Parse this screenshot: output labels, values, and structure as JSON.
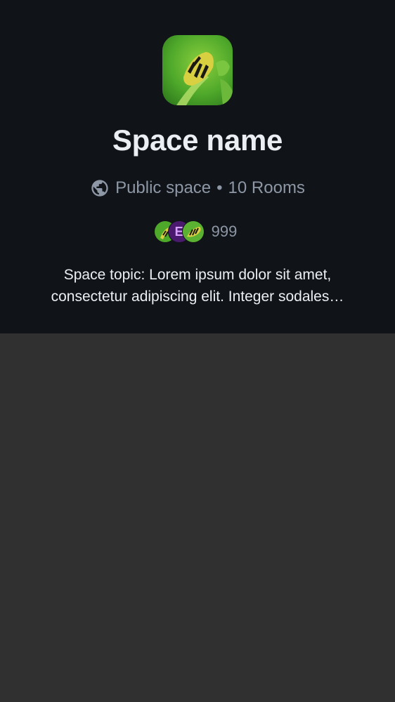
{
  "space": {
    "avatar_icon": "caterpillar-photo",
    "name": "Space name",
    "visibility_icon": "globe-icon",
    "visibility": "Public space",
    "separator": "•",
    "rooms": "10 Rooms",
    "member_avatars": [
      {
        "kind": "photo",
        "icon": "caterpillar-photo"
      },
      {
        "kind": "letter",
        "letter": "E"
      },
      {
        "kind": "photo",
        "icon": "caterpillar-photo"
      }
    ],
    "member_count": "999",
    "topic": "Space topic: Lorem ipsum dolor sit amet, consectetur adipiscing elit. Integer sodales…"
  },
  "colors": {
    "header_bg": "#101317",
    "body_bg": "#303030",
    "primary_text": "#ebeef2",
    "secondary_text": "#8d97a5"
  }
}
